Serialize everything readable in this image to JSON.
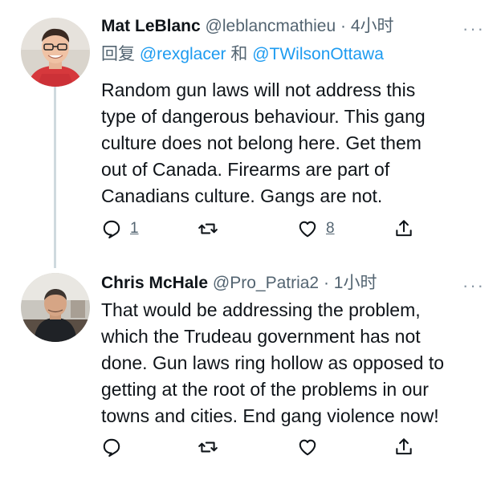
{
  "tweets": [
    {
      "name": "Mat LeBlanc",
      "handle": "@leblancmathieu",
      "separator": "·",
      "time": "4小时",
      "more": "···",
      "reply_prefix": "回复",
      "mention_1": "@rexglacer",
      "reply_joiner": "和",
      "mention_2": "@TWilsonOttawa",
      "lines": [
        "Random gun laws will not address this",
        "type of dangerous behaviour.  This gang",
        "culture does not belong here.  Get them",
        "out of Canada.  Firearms are part of",
        "Canadians culture.  Gangs are not."
      ],
      "reply_count": "1",
      "like_count": "8"
    },
    {
      "name": "Chris McHale",
      "handle": "@Pro_Patria2",
      "separator": "·",
      "time": "1小时",
      "more": "···",
      "lines": [
        "That would be addressing the problem,",
        "which the Trudeau government has not",
        "done.  Gun laws ring hollow as opposed to",
        "getting at the root of the problems in our",
        "towns and cities.  End gang violence now!"
      ]
    }
  ],
  "colors": {
    "accent": "#1d9bf0",
    "text": "#0f1419",
    "secondary": "#536471",
    "thread_line": "#cfd9de"
  },
  "icons": [
    "reply-icon",
    "retweet-icon",
    "like-icon",
    "share-icon",
    "more-icon"
  ]
}
